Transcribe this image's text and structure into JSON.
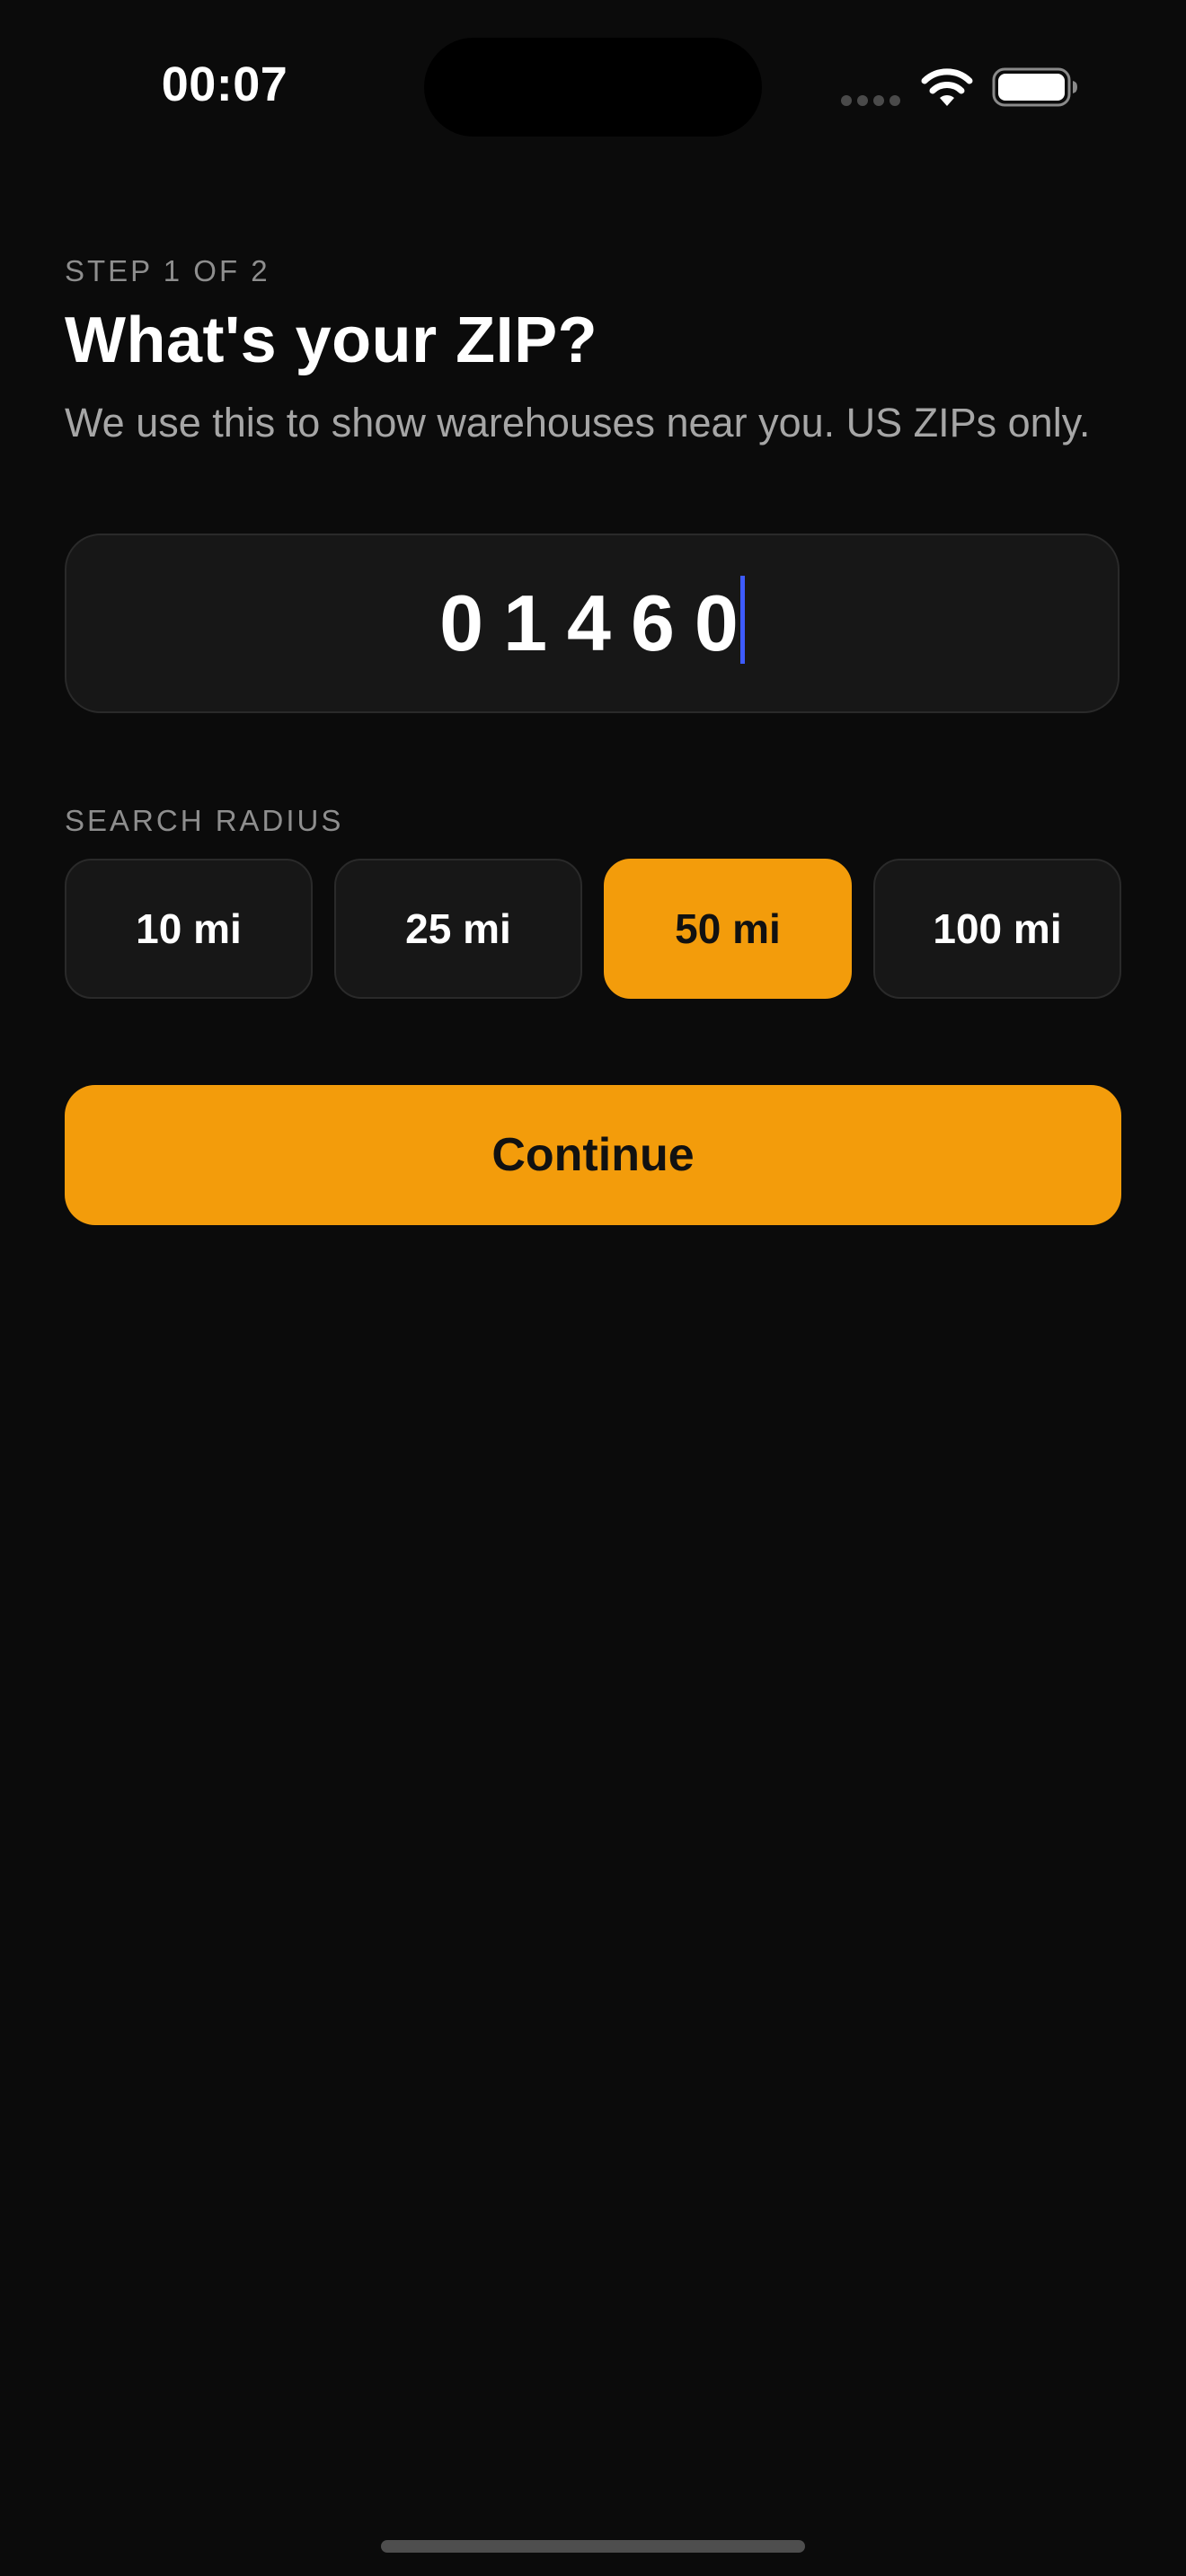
{
  "status_bar": {
    "time": "00:07",
    "signal_icon": "cellular-signal-icon",
    "wifi_icon": "wifi-icon",
    "battery_icon": "battery-icon"
  },
  "header": {
    "step": "STEP 1 OF 2",
    "title": "What's your ZIP?",
    "subtitle": "We use this to show warehouses near you. US ZIPs only."
  },
  "zip_input": {
    "value": "01460",
    "focused": true
  },
  "radius": {
    "label": "SEARCH RADIUS",
    "options": [
      {
        "label": "10 mi",
        "selected": false
      },
      {
        "label": "25 mi",
        "selected": false
      },
      {
        "label": "50 mi",
        "selected": true
      },
      {
        "label": "100 mi",
        "selected": false
      }
    ]
  },
  "actions": {
    "continue_label": "Continue"
  },
  "colors": {
    "accent": "#f39c0b",
    "background": "#0b0b0b",
    "surface": "#171717",
    "caret": "#3d5bff",
    "muted_text": "#8e8e8e"
  }
}
